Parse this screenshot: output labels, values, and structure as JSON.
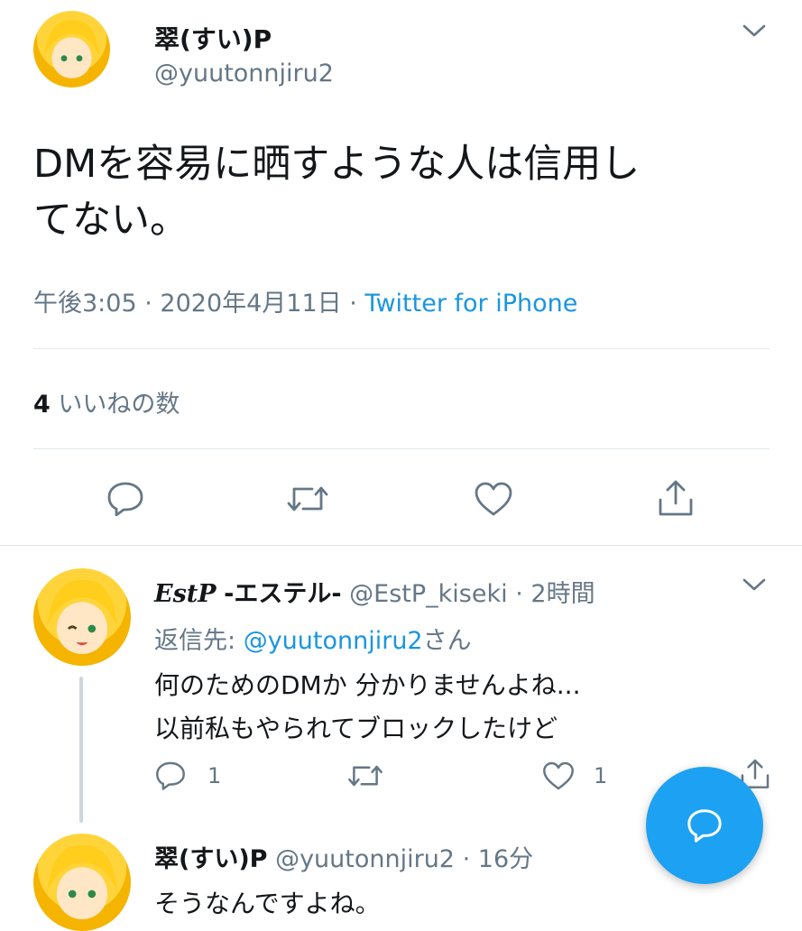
{
  "main_tweet": {
    "display_name": "翠(すい)P",
    "handle": "@yuutonnjiru2",
    "text_line1": "DMを容易に晒すような人は信用し",
    "text_line2": "てない。",
    "time": "午後3:05",
    "date": "2020年4月11日",
    "source": "Twitter for iPhone",
    "likes_count": "4",
    "likes_label": "いいねの数"
  },
  "reply": {
    "display_name": "EstP",
    "display_name_suffix": "-エステル-",
    "handle": "@EstP_kiseki",
    "time": "2時間",
    "reply_to_label": "返信先: ",
    "reply_to_handle": "@yuutonnjiru2",
    "reply_to_suffix": "さん",
    "text_line1": "何のためのDMか 分かりませんよね...",
    "text_line2": "以前私もやられてブロックしたけど",
    "reply_count": "1",
    "like_count": "1"
  },
  "reply2": {
    "display_name": "翠(すい)P",
    "handle": "@yuutonnjiru2",
    "time": "16分",
    "text_line1": "そうなんですよね。"
  },
  "icons": [
    "chevron-down-icon",
    "reply-icon",
    "retweet-icon",
    "like-icon",
    "share-icon",
    "compose-icon"
  ],
  "colors": {
    "link": "#1b95e0",
    "muted": "#657786",
    "fab": "#1da1f2"
  }
}
